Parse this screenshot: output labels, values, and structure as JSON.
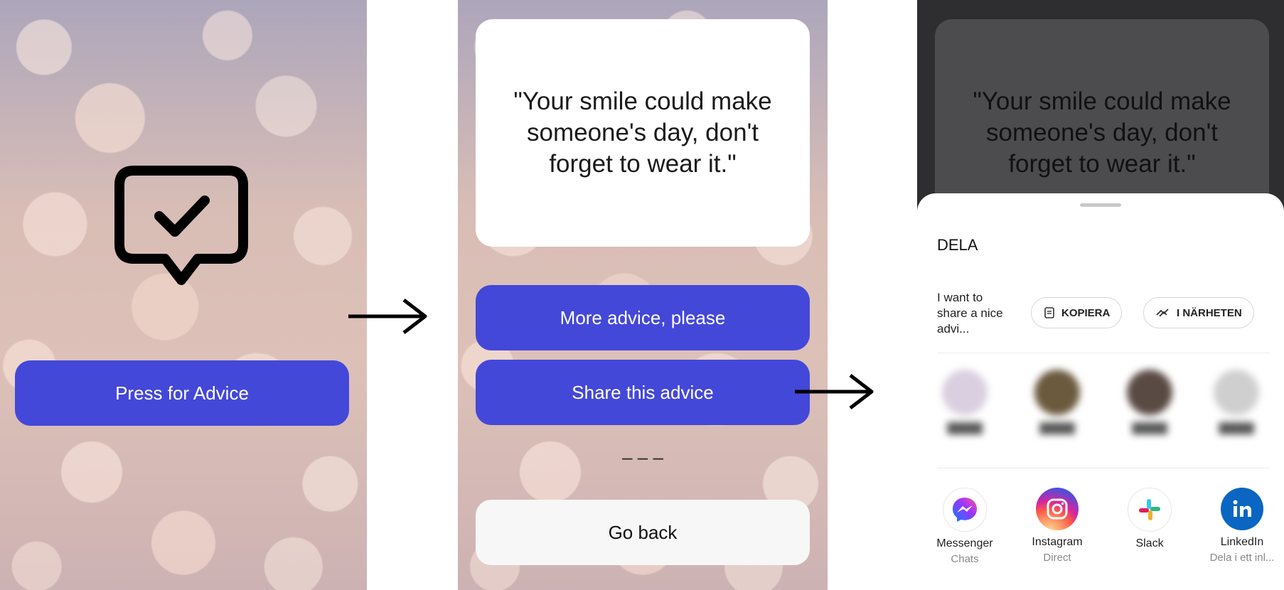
{
  "screen1": {
    "button_label": "Press for Advice",
    "icon": "speech-bubble-check-icon"
  },
  "screen2": {
    "quote": "\"Your smile could make someone's day, don't forget to wear it.\"",
    "more_button": "More advice, please",
    "share_button": "Share this advice",
    "separator": "– – –",
    "back_button": "Go back"
  },
  "screen3": {
    "quote": "\"Your smile could make someone's day, don't forget to wear it.\"",
    "sheet_title": "DELA",
    "share_text": "I want to share a nice advi...",
    "copy_chip": "KOPIERA",
    "nearby_chip": "I NÄRHETEN",
    "apps": [
      {
        "name": "Messenger",
        "sub": "Chats"
      },
      {
        "name": "Instagram",
        "sub": "Direct"
      },
      {
        "name": "Slack",
        "sub": ""
      },
      {
        "name": "LinkedIn",
        "sub": "Dela i ett inl..."
      }
    ]
  },
  "colors": {
    "primary": "#4448d8",
    "white": "#ffffff"
  }
}
